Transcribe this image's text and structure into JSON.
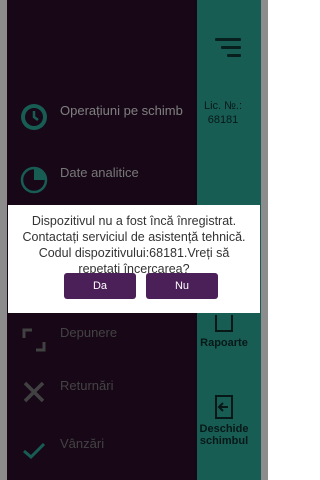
{
  "colors": {
    "sidebar_bg": "#2b0e2a",
    "right_panel_bg": "#2aa99a",
    "icon_teal": "#2aa99a",
    "button_bg": "#4b1f57"
  },
  "header": {
    "license_label": "Lic. №.:",
    "license_number": "68181"
  },
  "menu": {
    "items": [
      {
        "label": "Operațiuni pe schimb",
        "icon": "clock-icon"
      },
      {
        "label": "Date analitice",
        "icon": "pie-chart-icon"
      },
      {
        "label": "Depunere",
        "icon": "deposit-icon"
      },
      {
        "label": "Returnări",
        "icon": "return-icon"
      },
      {
        "label": "Vânzări",
        "icon": "check-icon"
      }
    ]
  },
  "side_buttons": {
    "reports": "Rapoarte",
    "open_shift": "Deschide schimbul"
  },
  "dialog": {
    "message": "Dispozitivul nu a fost încă înregistrat. Contactați serviciul de asistență tehnică. Codul dispozitivului:68181.Vreți să repetați încercarea?",
    "yes_label": "Da",
    "no_label": "Nu"
  }
}
